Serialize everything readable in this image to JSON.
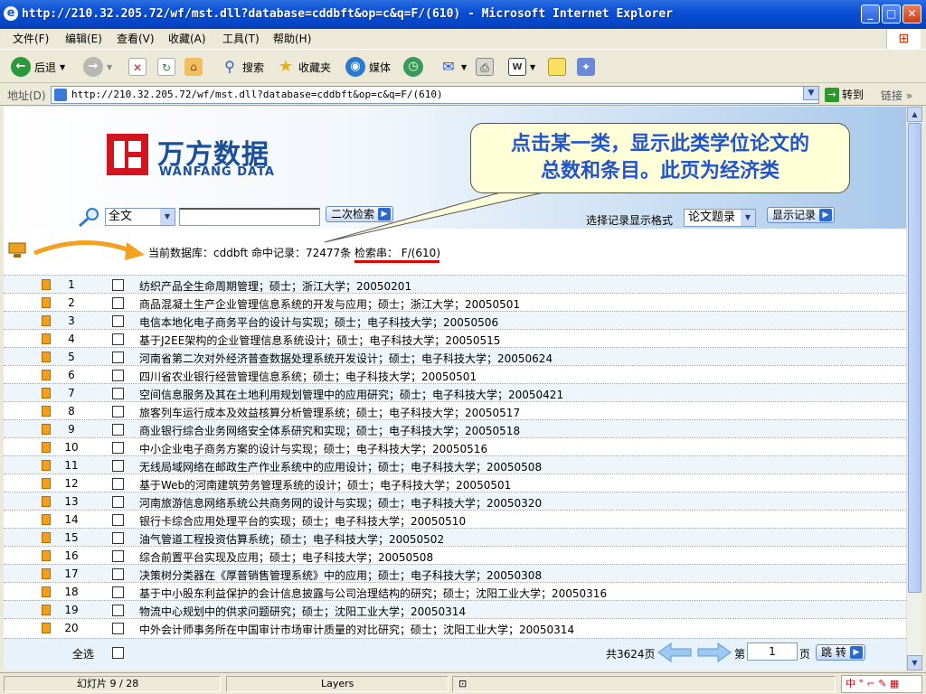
{
  "window": {
    "title": "http://210.32.205.72/wf/mst.dll?database=cddbft&op=c&q=F/(610) - Microsoft Internet Explorer",
    "minimize": "_",
    "maximize": "□",
    "close": "✕"
  },
  "menu": [
    "文件(F)",
    "编辑(E)",
    "查看(V)",
    "收藏(A)",
    "工具(T)",
    "帮助(H)"
  ],
  "toolbar": {
    "back": "后退",
    "search": "搜索",
    "favorites": "收藏夹",
    "media": "媒体"
  },
  "address": {
    "label": "地址(D)",
    "url": "http://210.32.205.72/wf/mst.dll?database=cddbft&op=c&q=F/(610)",
    "go": "转到",
    "links": "链接"
  },
  "logo": {
    "cn": "万方数据",
    "en": "WANFANG DATA"
  },
  "callout": {
    "line1": "点击某一类，显示此类学位论文的",
    "line2": "总数和条目。此页为经济类"
  },
  "search": {
    "scope": "全文",
    "second_search": "二次检索",
    "format_label": "选择记录显示格式",
    "format_value": "论文题录",
    "show_records": "显示记录"
  },
  "info": {
    "text": "当前数据库：cddbft   命中记录：72477条   检索串： F/(610)"
  },
  "results": [
    {
      "num": "1",
      "title": "纺织产品全生命周期管理；硕士；浙江大学；20050201"
    },
    {
      "num": "2",
      "title": "商品混凝土生产企业管理信息系统的开发与应用；硕士；浙江大学；20050501"
    },
    {
      "num": "3",
      "title": "电信本地化电子商务平台的设计与实现；硕士；电子科技大学；20050506"
    },
    {
      "num": "4",
      "title": "基于J2EE架构的企业管理信息系统设计；硕士；电子科技大学；20050515"
    },
    {
      "num": "5",
      "title": "河南省第二次对外经济普查数据处理系统开发设计；硕士；电子科技大学；20050624"
    },
    {
      "num": "6",
      "title": "四川省农业银行经营管理信息系统；硕士；电子科技大学；20050501"
    },
    {
      "num": "7",
      "title": "空间信息服务及其在土地利用规划管理中的应用研究；硕士；电子科技大学；20050421"
    },
    {
      "num": "8",
      "title": "旅客列车运行成本及效益核算分析管理系统；硕士；电子科技大学；20050517"
    },
    {
      "num": "9",
      "title": "商业银行综合业务网络安全体系研究和实现；硕士；电子科技大学；20050518"
    },
    {
      "num": "10",
      "title": "中小企业电子商务方案的设计与实现；硕士；电子科技大学；20050516"
    },
    {
      "num": "11",
      "title": "无线局域网络在邮政生产作业系统中的应用设计；硕士；电子科技大学；20050508"
    },
    {
      "num": "12",
      "title": "基于Web的河南建筑劳务管理系统的设计；硕士；电子科技大学；20050501"
    },
    {
      "num": "13",
      "title": "河南旅游信息网络系统公共商务网的设计与实现；硕士；电子科技大学；20050320"
    },
    {
      "num": "14",
      "title": "银行卡综合应用处理平台的实现；硕士；电子科技大学；20050510"
    },
    {
      "num": "15",
      "title": "油气管道工程投资估算系统；硕士；电子科技大学；20050502"
    },
    {
      "num": "16",
      "title": "综合前置平台实现及应用；硕士；电子科技大学；20050508"
    },
    {
      "num": "17",
      "title": "决策树分类器在《厚普销售管理系统》中的应用；硕士；电子科技大学；20050308"
    },
    {
      "num": "18",
      "title": "基于中小股东利益保护的会计信息披露与公司治理结构的研究；硕士；沈阳工业大学；20050316"
    },
    {
      "num": "19",
      "title": "物流中心规划中的供求问题研究；硕士；沈阳工业大学；20050314"
    },
    {
      "num": "20",
      "title": "中外会计师事务所在中国审计市场审计质量的对比研究；硕士；沈阳工业大学；20050314"
    }
  ],
  "footer": {
    "select_all": "全选",
    "total_pages": "共3624页",
    "page_prefix": "第",
    "page_value": "1",
    "page_suffix": "页",
    "jump": "跳 转"
  },
  "status": {
    "slide": "幻灯片 9 / 28",
    "layers": "Layers"
  },
  "colors": {
    "title_bar": "#0a4fd6",
    "callout_text": "#2255cc",
    "logo_red": "#d2141e",
    "logo_blue": "#1b4f9a",
    "underline": "#dd0000"
  }
}
